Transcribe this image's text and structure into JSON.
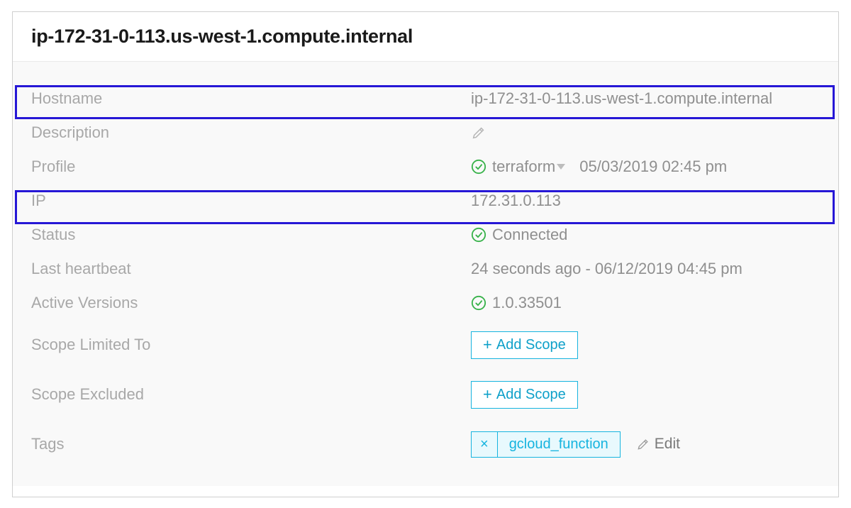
{
  "header": {
    "title": "ip-172-31-0-113.us-west-1.compute.internal"
  },
  "fields": {
    "hostname": {
      "label": "Hostname",
      "value": "ip-172-31-0-113.us-west-1.compute.internal"
    },
    "description": {
      "label": "Description"
    },
    "profile": {
      "label": "Profile",
      "value": "terraform",
      "timestamp": "05/03/2019 02:45 pm"
    },
    "ip": {
      "label": "IP",
      "value": "172.31.0.113"
    },
    "status": {
      "label": "Status",
      "value": "Connected"
    },
    "heartbeat": {
      "label": "Last heartbeat",
      "value": "24 seconds ago - 06/12/2019 04:45 pm"
    },
    "versions": {
      "label": "Active Versions",
      "value": "1.0.33501"
    },
    "scope_limited": {
      "label": "Scope Limited To",
      "button": "Add Scope"
    },
    "scope_excluded": {
      "label": "Scope Excluded",
      "button": "Add Scope"
    },
    "tags": {
      "label": "Tags",
      "items": [
        "gcloud_function"
      ],
      "edit_label": "Edit"
    }
  },
  "colors": {
    "highlight_border": "#2617d6",
    "accent_green": "#38b24a",
    "accent_blue": "#16b4df"
  }
}
